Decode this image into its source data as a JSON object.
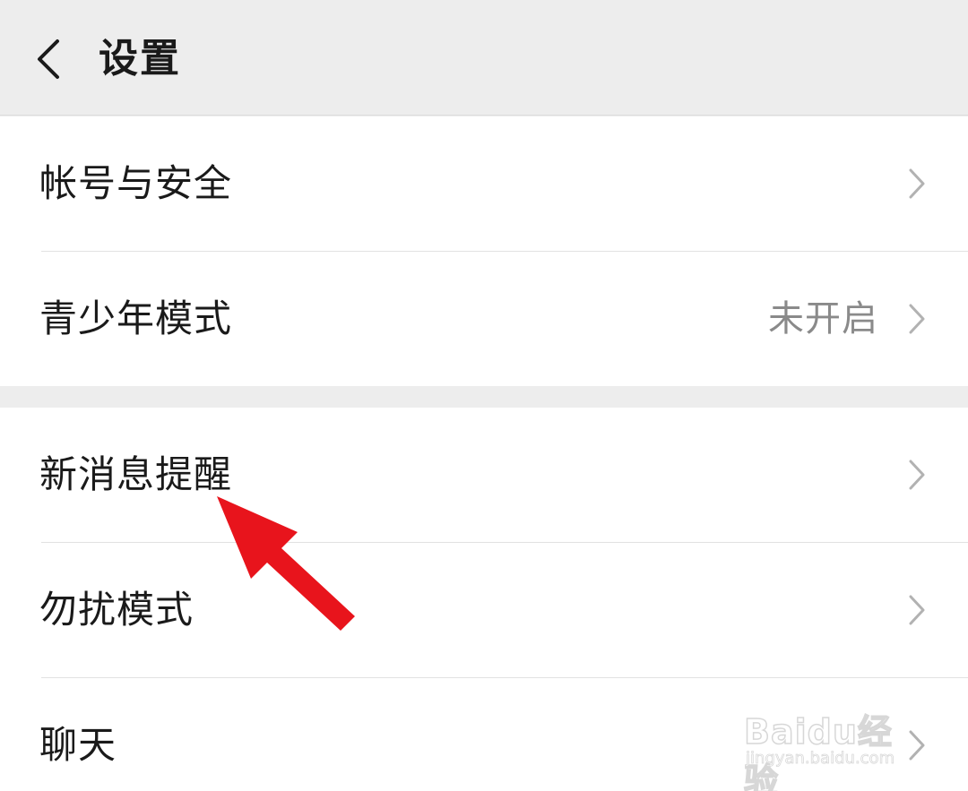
{
  "header": {
    "title": "设置",
    "back_icon": "chevron-left-icon"
  },
  "settings": {
    "group1": [
      {
        "label": "帐号与安全",
        "value": ""
      },
      {
        "label": "青少年模式",
        "value": "未开启"
      }
    ],
    "group2": [
      {
        "label": "新消息提醒",
        "value": ""
      },
      {
        "label": "勿扰模式",
        "value": ""
      },
      {
        "label": "聊天",
        "value": ""
      }
    ]
  },
  "annotation": {
    "arrow_color": "#e8141c",
    "icon": "red-arrow-icon"
  },
  "watermark": {
    "logo_text": "Baidu经验",
    "url": "jingyan.baidu.com"
  },
  "colors": {
    "background": "#ededed",
    "row_background": "#ffffff",
    "label_text": "#1a1a1a",
    "value_text": "#8a8a8a",
    "chevron": "#b2b2b2"
  }
}
